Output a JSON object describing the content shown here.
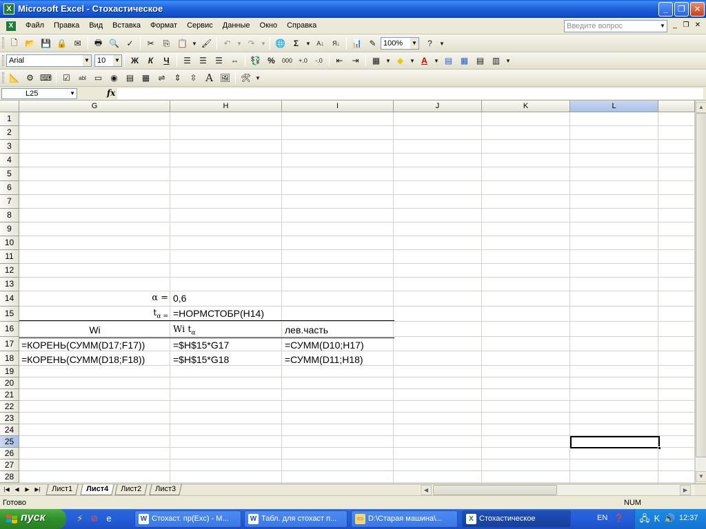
{
  "window": {
    "title": "Microsoft Excel - Стохастическое"
  },
  "menu": {
    "items": [
      "Файл",
      "Правка",
      "Вид",
      "Вставка",
      "Формат",
      "Сервис",
      "Данные",
      "Окно",
      "Справка"
    ],
    "question_placeholder": "Введите вопрос"
  },
  "toolbar": {
    "zoom": "100%",
    "font_name": "Arial",
    "font_size": "10",
    "bold": "Ж",
    "italic": "К",
    "underline": "Ч",
    "percent": "%",
    "thousands": "000"
  },
  "formula_bar": {
    "name_box": "L25",
    "fx": "fx",
    "formula": ""
  },
  "grid": {
    "columns": [
      "G",
      "H",
      "I",
      "J",
      "K",
      "L"
    ],
    "selected_column": "L",
    "rows": [
      "1",
      "2",
      "3",
      "4",
      "5",
      "6",
      "7",
      "8",
      "9",
      "10",
      "11",
      "12",
      "13",
      "14",
      "15",
      "16",
      "17",
      "18",
      "19",
      "20",
      "21",
      "22",
      "23",
      "24",
      "25",
      "26",
      "27",
      "28"
    ],
    "selected_row": "25",
    "cells": {
      "g14": "α =",
      "h14": "0,6",
      "g15_t": "t",
      "g15_sub": "α =",
      "h15": "=НОРМСТОБР(H14)",
      "g16": "Wi",
      "h16_main": "Wi t",
      "h16_sub": "α",
      "i16": "лев.часть",
      "g17": "=КОРЕНЬ(СУММ(D17;F17))",
      "h17": "=$H$15*G17",
      "i17": "=СУММ(D10;H17)",
      "g18": "=КОРЕНЬ(СУММ(D18;F18))",
      "h18": "=$H$15*G18",
      "i18": "=СУММ(D11;H18)"
    }
  },
  "sheets": {
    "tabs": [
      "Лист1",
      "Лист4",
      "Лист2",
      "Лист3"
    ],
    "active": "Лист4"
  },
  "status": {
    "text": "Готово",
    "num": "NUM"
  },
  "taskbar": {
    "start": "пуск",
    "tasks": [
      "Стохаст. пр(Exc) - M...",
      "Табл. для стохаст п...",
      "D:\\Старая машина\\...",
      "Стохастическое"
    ],
    "lang": "EN",
    "clock": "12:37"
  }
}
